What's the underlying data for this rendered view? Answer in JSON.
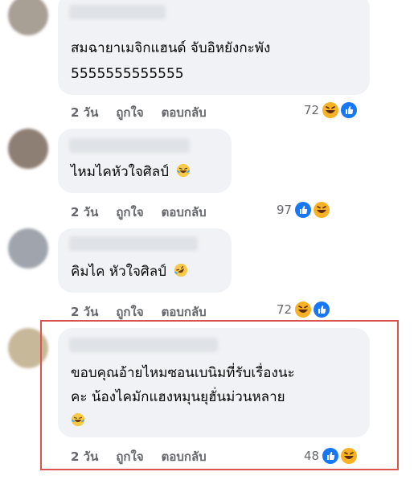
{
  "comments": [
    {
      "text_lines": [
        "สมฉายาเมจิกแฮนด์ จับอิหยังกะพัง",
        "5555555555555"
      ],
      "time": "2 วัน",
      "like": "ถูกใจ",
      "reply": "ตอบกลับ",
      "reaction_count": "72",
      "reactions": [
        "haha",
        "like"
      ]
    },
    {
      "text_lines": [
        "ไหมไคหัวใจศิลป์"
      ],
      "inline_emoji": "laugh-tears",
      "time": "2 วัน",
      "like": "ถูกใจ",
      "reply": "ตอบกลับ",
      "reaction_count": "97",
      "reactions": [
        "like",
        "haha"
      ]
    },
    {
      "text_lines": [
        "คิมไค หัวใจศิลป์"
      ],
      "inline_emoji": "rofl",
      "time": "2 วัน",
      "like": "ถูกใจ",
      "reply": "ตอบกลับ",
      "reaction_count": "72",
      "reactions": [
        "haha",
        "like"
      ]
    },
    {
      "text_lines": [
        "ขอบคุณอ้ายไหมซอนเบนิมที่รับเรื่องนะ",
        "คะ น้องไคมักแฮงหมุนยุฮั่นม่วนหลาย"
      ],
      "inline_emoji": "laugh-tears",
      "time": "2 วัน",
      "like": "ถูกใจ",
      "reply": "ตอบกลับ",
      "reaction_count": "48",
      "reactions": [
        "like",
        "haha"
      ]
    }
  ],
  "colors": {
    "bubble": "#f0f2f5",
    "meta_text": "#65676b",
    "highlight_border": "#d9534f",
    "like_blue": "#1877f2",
    "haha_yellow": "#f7b125"
  }
}
